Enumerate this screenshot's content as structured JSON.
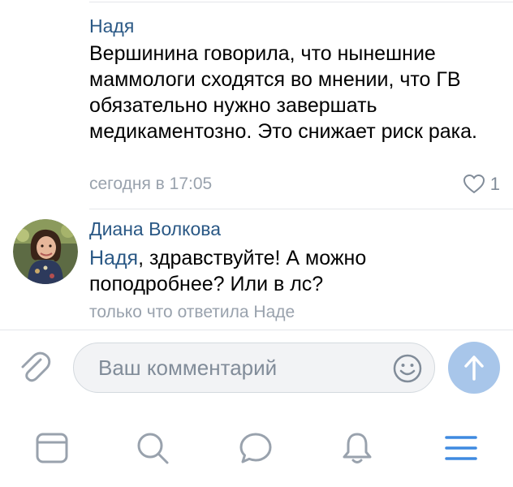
{
  "comments": [
    {
      "author": "Надя",
      "text": "Вершинина говорила, что нынешние маммологи сходятся во мнении, что ГВ обязательно нужно завершать медикаментозно. Это снижает риск рака.",
      "time": "сегодня в 17:05",
      "likes": "1"
    },
    {
      "author": "Диана Волкова",
      "mention": "Надя",
      "text": ", здравствуйте! А можно поподробнее? Или в лс?",
      "meta": "только что ответила Наде"
    }
  ],
  "composer": {
    "placeholder": "Ваш комментарий"
  },
  "icons": {
    "attach": "paperclip-icon",
    "emoji": "smile-icon",
    "send": "arrow-up-icon",
    "tabs": [
      "feed-icon",
      "search-icon",
      "messages-icon",
      "notifications-icon",
      "menu-icon"
    ]
  },
  "colors": {
    "link": "#2a5885",
    "meta": "#99a2ad",
    "send_button": "#a8c6ea",
    "tab_icon": "#99a2ad",
    "tab_active": "#3f8ae0"
  }
}
